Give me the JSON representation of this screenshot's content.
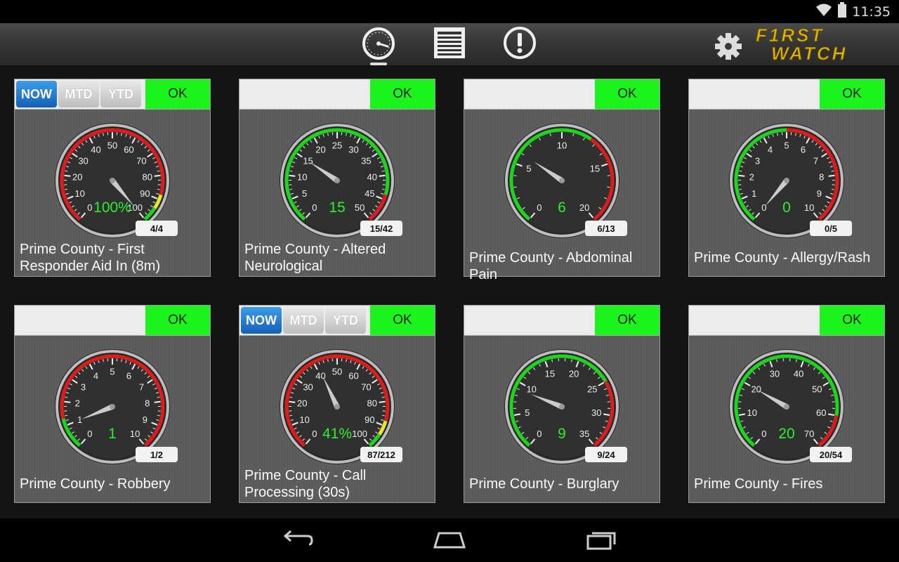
{
  "status_bar": {
    "time": "11:35",
    "icons": [
      "wifi-icon",
      "battery-icon"
    ]
  },
  "toolbar": {
    "buttons": [
      {
        "name": "gauge-view-icon",
        "active": true
      },
      {
        "name": "list-view-icon",
        "active": false
      },
      {
        "name": "alerts-icon",
        "active": false
      }
    ],
    "settings_icon": "gear-icon",
    "logo_text": [
      "F1RST",
      "WATCH"
    ]
  },
  "colors": {
    "ok": "#1bf51b",
    "needle": "#cccccc",
    "good_arc": "#1bd61b",
    "bad_arc": "#e01b1b",
    "warn_arc": "#e8e81b",
    "value_text": "#2af02a"
  },
  "segment_labels": [
    "NOW",
    "MTD",
    "YTD"
  ],
  "cards": [
    {
      "title": "Prime County - First Responder Aid In (8m)",
      "ok_label": "OK",
      "has_segment": true,
      "active_segment": 0,
      "count": "4/4",
      "value_text": "100%",
      "gauge": {
        "min": 0,
        "max": 100,
        "ticks": [
          0,
          10,
          20,
          30,
          40,
          50,
          60,
          70,
          80,
          90,
          100
        ],
        "value": 100,
        "zones": [
          {
            "from": 0,
            "to": 88,
            "color": "red"
          },
          {
            "from": 88,
            "to": 94,
            "color": "yellow"
          },
          {
            "from": 94,
            "to": 100,
            "color": "green"
          }
        ]
      }
    },
    {
      "title": "Prime County - Altered Neurological",
      "ok_label": "OK",
      "has_segment": false,
      "count": "15/42",
      "value_text": "15",
      "gauge": {
        "min": 0,
        "max": 50,
        "ticks": [
          0,
          5,
          10,
          15,
          20,
          25,
          30,
          35,
          40,
          45,
          50
        ],
        "value": 15,
        "zones": [
          {
            "from": 0,
            "to": 44,
            "color": "green"
          },
          {
            "from": 44,
            "to": 50,
            "color": "red"
          }
        ]
      }
    },
    {
      "title": "Prime County - Abdominal Pain",
      "ok_label": "OK",
      "has_segment": false,
      "count": "6/13",
      "value_text": "6",
      "gauge": {
        "min": 0,
        "max": 20,
        "ticks": [
          0,
          5,
          10,
          15,
          20
        ],
        "value": 6,
        "zones": [
          {
            "from": 0,
            "to": 12.5,
            "color": "green"
          },
          {
            "from": 12.5,
            "to": 20,
            "color": "red"
          }
        ]
      }
    },
    {
      "title": "Prime County - Allergy/Rash",
      "ok_label": "OK",
      "has_segment": false,
      "count": "0/5",
      "value_text": "0",
      "gauge": {
        "min": 0,
        "max": 10,
        "ticks": [
          0,
          1,
          2,
          3,
          4,
          5,
          6,
          7,
          8,
          9,
          10
        ],
        "value": 0,
        "zones": [
          {
            "from": 0,
            "to": 5,
            "color": "green"
          },
          {
            "from": 5,
            "to": 10,
            "color": "red"
          }
        ]
      }
    },
    {
      "title": "Prime County - Robbery",
      "ok_label": "OK",
      "has_segment": false,
      "count": "1/2",
      "value_text": "1",
      "gauge": {
        "min": 0,
        "max": 10,
        "ticks": [
          0,
          1,
          2,
          3,
          4,
          5,
          6,
          7,
          8,
          9,
          10
        ],
        "value": 1,
        "zones": [
          {
            "from": 0,
            "to": 1.3,
            "color": "green"
          },
          {
            "from": 1.3,
            "to": 10,
            "color": "red"
          }
        ]
      }
    },
    {
      "title": "Prime County - Call Processing (30s)",
      "ok_label": "OK",
      "has_segment": true,
      "active_segment": 0,
      "count": "87/212",
      "value_text": "41%",
      "gauge": {
        "min": 0,
        "max": 100,
        "ticks": [
          0,
          10,
          20,
          30,
          40,
          50,
          60,
          70,
          80,
          90,
          100
        ],
        "value": 41,
        "zones": [
          {
            "from": 0,
            "to": 88,
            "color": "red"
          },
          {
            "from": 88,
            "to": 94,
            "color": "yellow"
          },
          {
            "from": 94,
            "to": 100,
            "color": "green"
          }
        ]
      }
    },
    {
      "title": "Prime County - Burglary",
      "ok_label": "OK",
      "has_segment": false,
      "count": "9/24",
      "value_text": "9",
      "gauge": {
        "min": 0,
        "max": 35,
        "ticks": [
          0,
          5,
          10,
          15,
          20,
          25,
          30,
          35
        ],
        "value": 9,
        "zones": [
          {
            "from": 0,
            "to": 25,
            "color": "green"
          },
          {
            "from": 25,
            "to": 35,
            "color": "red"
          }
        ]
      }
    },
    {
      "title": "Prime County - Fires",
      "ok_label": "OK",
      "has_segment": false,
      "count": "20/54",
      "value_text": "20",
      "gauge": {
        "min": 0,
        "max": 70,
        "ticks": [
          0,
          10,
          20,
          30,
          40,
          50,
          60,
          70
        ],
        "value": 20,
        "zones": [
          {
            "from": 0,
            "to": 60,
            "color": "green"
          },
          {
            "from": 60,
            "to": 70,
            "color": "red"
          }
        ]
      }
    }
  ],
  "nav_bar": {
    "buttons": [
      "back-icon",
      "home-icon",
      "recents-icon"
    ]
  }
}
